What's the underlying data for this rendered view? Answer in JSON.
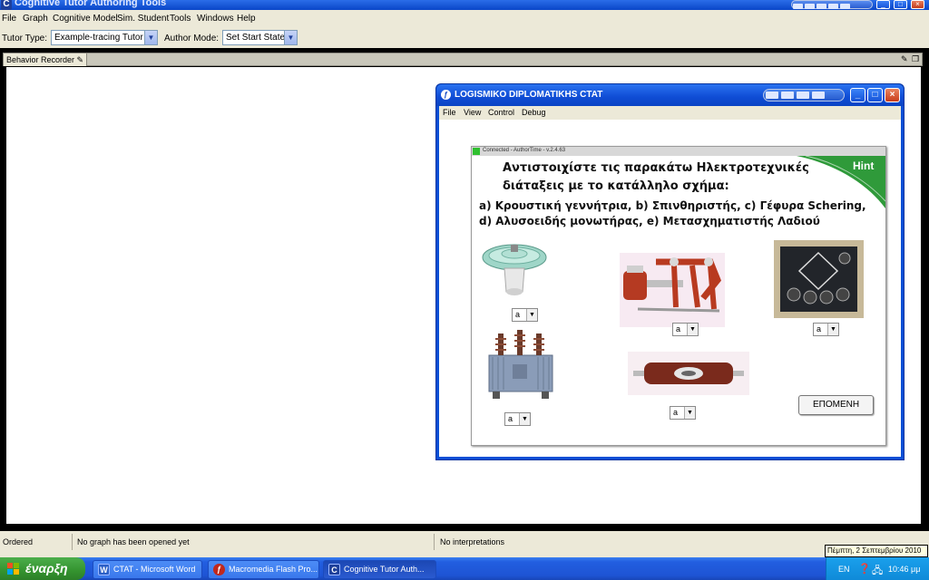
{
  "app": {
    "title": "Cognitive Tutor Authoring Tools",
    "menu": [
      "File",
      "Graph",
      "Cognitive Model",
      "Sim. Student",
      "Tools",
      "Windows",
      "Help"
    ]
  },
  "toolbar": {
    "tutor_type_label": "Tutor Type:",
    "tutor_type_value": "Example-tracing Tutor",
    "author_mode_label": "Author Mode:",
    "author_mode_value": "Set Start State"
  },
  "panel": {
    "tab_label": "Behavior Recorder"
  },
  "status": {
    "ordered": "Ordered",
    "graph": "No graph has been opened yet",
    "interpretations": "No interpretations"
  },
  "inner_window": {
    "title": "LOGISMIKO DIPLOMATIKHS CTAT",
    "menu": [
      "File",
      "View",
      "Control",
      "Debug"
    ]
  },
  "tutor": {
    "connection": "Connected - AuthorTime - v.2.4.63",
    "hint_label": "Hint",
    "question_line1": "Αντιστοιχίστε τις παρακάτω Ηλεκτροτεχνικές",
    "question_line2": "διάταξεις με το κατάλληλο σχήμα:",
    "options_line1": "a) Κρουστική γεννήτρια, b) Σπινθηριστής, c) Γέφυρα Schering,",
    "options_line2": "d) Αλυσοειδής μονωτήρας, e) Μετασχηματιστής Λαδιού",
    "dropdowns": [
      "a",
      "a",
      "a",
      "a",
      "a"
    ],
    "next_button": "ΕΠΟΜΕΝΗ",
    "images": [
      "glass-insulator",
      "impulse-generator",
      "schering-bridge",
      "oil-transformer",
      "spark-gap"
    ]
  },
  "taskbar": {
    "start": "έναρξη",
    "tasks": [
      "CTAT - Microsoft Word",
      "Macromedia Flash Pro...",
      "Cognitive Tutor Auth..."
    ],
    "language": "EN",
    "clock": "10:46 μμ",
    "tooltip": "Πέμπτη, 2 Σεπτεμβρίου 2010"
  },
  "colors": {
    "xp_blue": "#0a46c8",
    "hint_green": "#2f9a3a",
    "start_green": "#34932f",
    "window_face": "#ece9d8"
  }
}
